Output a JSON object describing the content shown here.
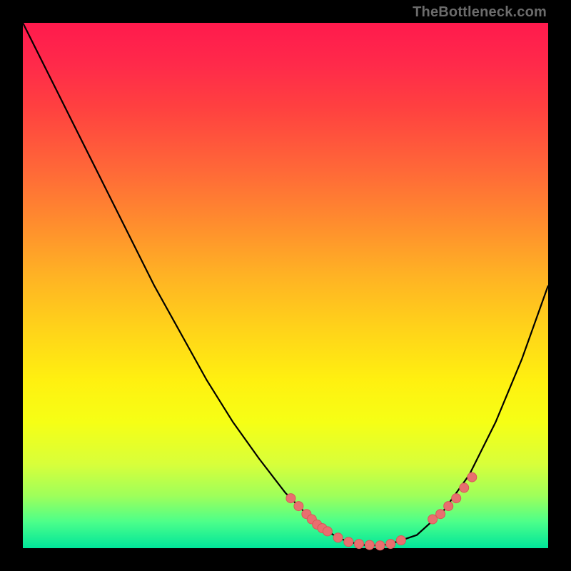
{
  "watermark": "TheBottleneck.com",
  "colors": {
    "curve": "#000000",
    "marker_fill": "#e86f6f",
    "marker_stroke": "#d95858"
  },
  "chart_data": {
    "type": "line",
    "title": "",
    "xlabel": "",
    "ylabel": "",
    "xlim": [
      0,
      100
    ],
    "ylim": [
      0,
      100
    ],
    "series": [
      {
        "name": "bottleneck-curve",
        "x": [
          0,
          5,
          10,
          15,
          20,
          25,
          30,
          35,
          40,
          45,
          50,
          55,
          58,
          60,
          62,
          65,
          68,
          70,
          75,
          80,
          85,
          90,
          95,
          100
        ],
        "values": [
          100,
          90,
          80,
          70,
          60,
          50,
          41,
          32,
          24,
          17,
          10.5,
          5.5,
          3.2,
          2,
          1.2,
          0.6,
          0.5,
          0.8,
          2.5,
          7,
          14,
          24,
          36,
          50
        ]
      },
      {
        "name": "markers-left-cluster",
        "type": "scatter",
        "x": [
          51,
          52.5,
          54,
          55,
          56,
          57,
          58
        ],
        "values": [
          9.5,
          8,
          6.5,
          5.5,
          4.5,
          3.8,
          3.2
        ]
      },
      {
        "name": "markers-bottom-cluster",
        "type": "scatter",
        "x": [
          60,
          62,
          64,
          66,
          68,
          70,
          72
        ],
        "values": [
          2,
          1.2,
          0.8,
          0.6,
          0.5,
          0.8,
          1.5
        ]
      },
      {
        "name": "markers-right-cluster",
        "type": "scatter",
        "x": [
          78,
          79.5,
          81,
          82.5,
          84,
          85.5
        ],
        "values": [
          5.5,
          6.5,
          8,
          9.5,
          11.5,
          13.5
        ]
      }
    ]
  }
}
